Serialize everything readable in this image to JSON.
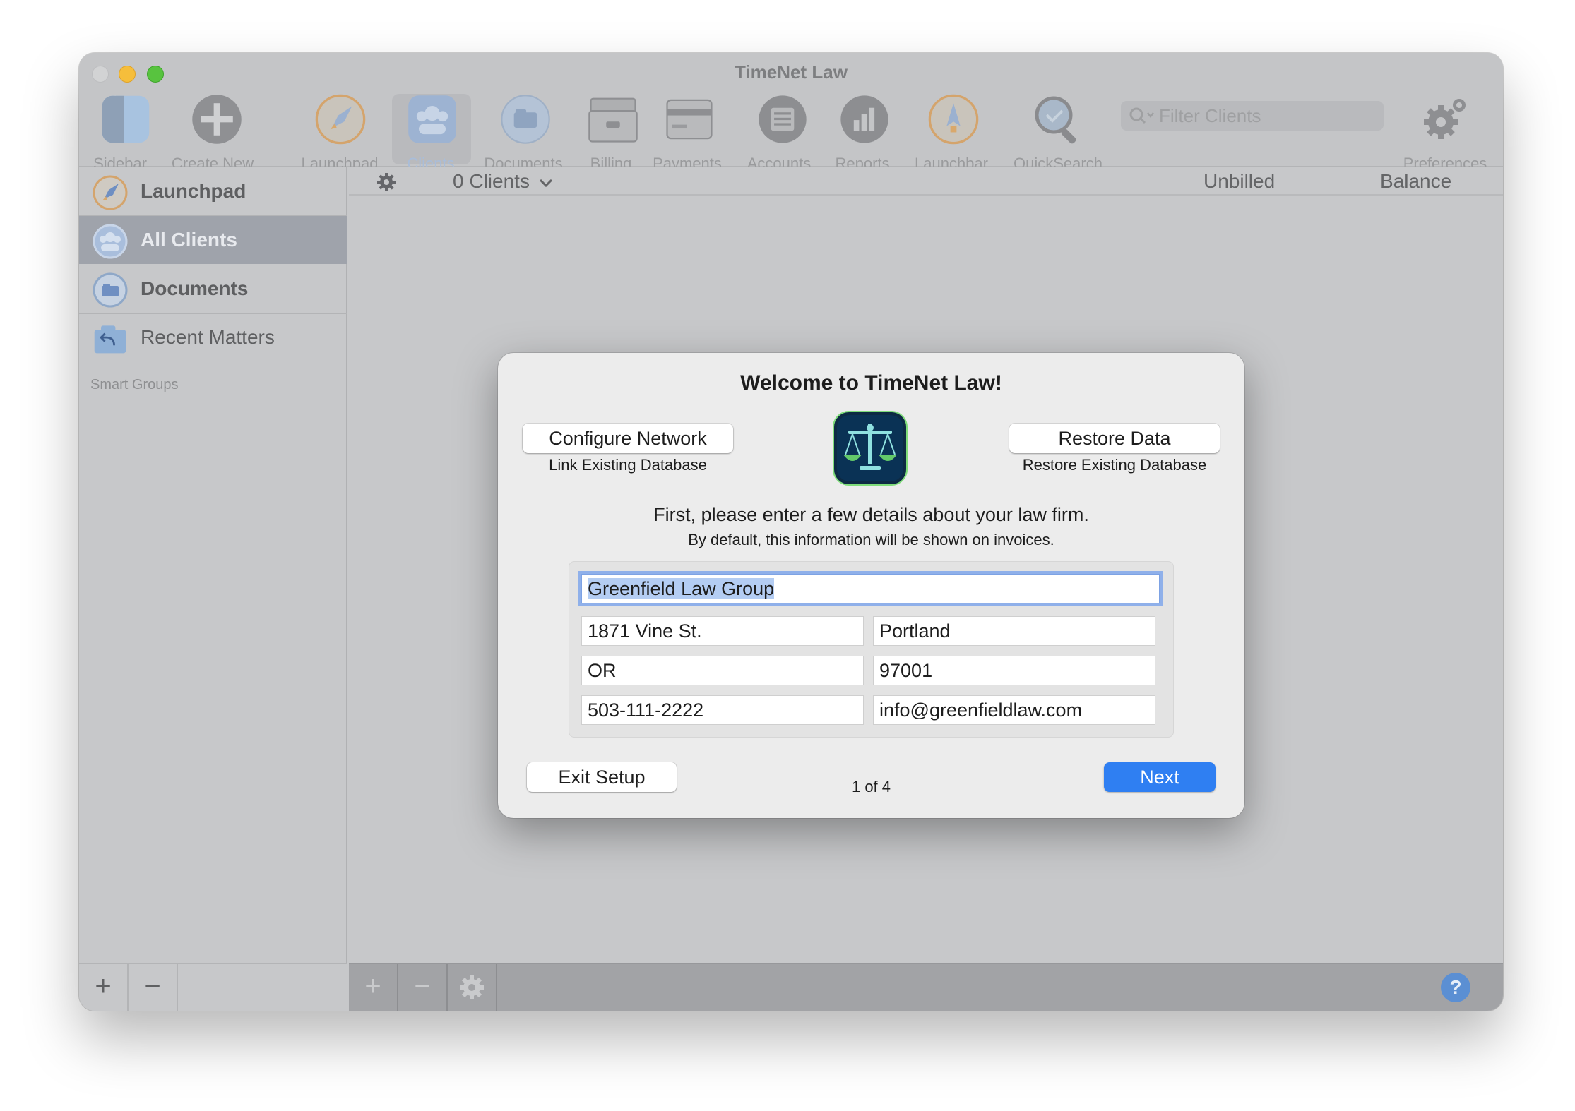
{
  "window": {
    "title": "TimeNet Law"
  },
  "toolbar": {
    "items": [
      {
        "label": "Sidebar",
        "icon": "sidebar-icon"
      },
      {
        "label": "Create New",
        "icon": "plus-circle-icon"
      },
      {
        "label": "Launchpad",
        "icon": "rocket-icon"
      },
      {
        "label": "Clients",
        "icon": "clients-icon"
      },
      {
        "label": "Documents",
        "icon": "documents-icon"
      },
      {
        "label": "Billing",
        "icon": "billing-icon"
      },
      {
        "label": "Payments",
        "icon": "payments-icon"
      },
      {
        "label": "Accounts",
        "icon": "accounts-icon"
      },
      {
        "label": "Reports",
        "icon": "reports-icon"
      },
      {
        "label": "Launchbar",
        "icon": "launchbar-icon"
      },
      {
        "label": "QuickSearch",
        "icon": "quicksearch-icon"
      }
    ],
    "filter_placeholder": "Filter Clients",
    "preferences_label": "Preferences"
  },
  "sidebar": {
    "items": [
      {
        "label": "Launchpad",
        "icon": "rocket-icon"
      },
      {
        "label": "All Clients",
        "icon": "clients-icon"
      },
      {
        "label": "Documents",
        "icon": "documents-icon"
      },
      {
        "label": "Recent Matters",
        "icon": "recent-matters-icon"
      }
    ],
    "smart_groups_label": "Smart Groups",
    "add_label": "+",
    "remove_label": "−"
  },
  "main": {
    "clients_count": "0 Clients",
    "col_unbilled": "Unbilled",
    "col_balance": "Balance",
    "add_label": "+",
    "remove_label": "−",
    "help_label": "?"
  },
  "dialog": {
    "title": "Welcome to TimeNet Law!",
    "configure_network_label": "Configure Network",
    "configure_network_sub": "Link Existing Database",
    "restore_data_label": "Restore Data",
    "restore_data_sub": "Restore Existing Database",
    "intro": "First, please enter a few details about your law firm.",
    "intro_sub": "By default, this information will be shown on invoices.",
    "fields": {
      "firm_name": "Greenfield Law Group",
      "street": "1871 Vine St.",
      "city": "Portland",
      "state": "OR",
      "zip": "97001",
      "phone": "503-111-2222",
      "email": "info@greenfieldlaw.com"
    },
    "exit_label": "Exit Setup",
    "page_indicator": "1 of 4",
    "next_label": "Next"
  },
  "colors": {
    "accent": "#2f7ff2",
    "sidebar_selected": "#9fa3ab",
    "window_bg": "#c7c8ca",
    "dialog_bg": "#ececec"
  }
}
